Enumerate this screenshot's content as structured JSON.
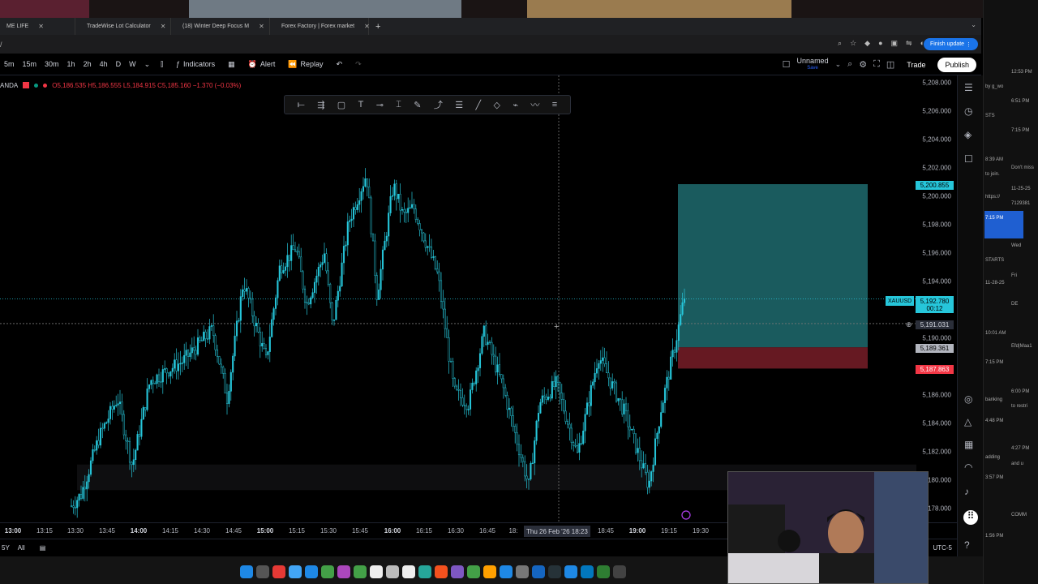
{
  "colors": {
    "accent": "#26c6da",
    "down": "#f23645",
    "up": "#089981",
    "target_zone": "#1e6b6e",
    "stop_zone": "#6b1a24",
    "blue_button": "#1a73e8"
  },
  "browser": {
    "tabs": [
      {
        "label": "ME LIFE",
        "icon": "tab-favicon"
      },
      {
        "label": "TradeWise Lot Calculator",
        "icon": "tab-favicon"
      },
      {
        "label": "(18) Winter Deep Focus M",
        "icon": "youtube-icon"
      },
      {
        "label": "Forex Factory | Forex market",
        "icon": "tab-favicon"
      }
    ],
    "address_fragment": "/",
    "finish_update": "Finish update"
  },
  "toolbar": {
    "timeframes": [
      "5m",
      "15m",
      "30m",
      "1h",
      "2h",
      "4h",
      "D",
      "W"
    ],
    "indicators_label": "Indicators",
    "alert_label": "Alert",
    "replay_label": "Replay",
    "layout_name": "Unnamed",
    "layout_sub": "Save",
    "trade_label": "Trade",
    "publish_label": "Publish"
  },
  "legend": {
    "symbol": "ANDA",
    "ohlc": "O5,186.535  H5,186.555  L5,184.915  C5,185.160  −1.370 (−0.03%)"
  },
  "drawing_tools": [
    "horizontal-line-icon",
    "channel-icon",
    "rectangle-icon",
    "text-icon",
    "ray-icon",
    "fib-icon",
    "brush-icon",
    "curve-icon",
    "parallel-channel-icon",
    "trend-line-icon",
    "shape-icon",
    "path-icon",
    "wave-icon",
    "menu-icon"
  ],
  "price_axis": {
    "ticks": [
      "5,208.000",
      "5,206.000",
      "5,204.000",
      "5,202.000",
      "5,200.000",
      "5,198.000",
      "5,196.000",
      "5,194.000",
      "5,190.000",
      "5,186.000",
      "5,184.000",
      "5,182.000",
      "5,180.000",
      "5,178.000"
    ],
    "target_label": "5,200.855",
    "last_price": "5,192.780",
    "countdown": "00:12",
    "crosshair_price": "5,191.031",
    "entry_label": "5,189.361",
    "stop_label": "5,187.863",
    "symbol_tag": "XAUUSD"
  },
  "time_axis": {
    "ticks": [
      "13:00",
      "13:15",
      "13:30",
      "13:45",
      "14:00",
      "14:15",
      "14:30",
      "14:45",
      "15:00",
      "15:15",
      "15:30",
      "15:45",
      "16:00",
      "16:15",
      "16:30",
      "16:45",
      "18:",
      "18:45",
      "19:00",
      "19:15",
      "19:30"
    ],
    "crosshair_time": "Thu 26 Feb '26   18:23"
  },
  "bottom": {
    "range": "5Y",
    "all": "All",
    "timezone": "UTC-5"
  },
  "side_panel": {
    "notes": [
      "12:53 PM",
      "by g_wo",
      "6:51 PM",
      "STS",
      "7:15 PM",
      "8:39 AM",
      "Don't miss",
      "to join.",
      "11-25-25",
      "https://",
      "7129381",
      "7:15 PM",
      "Wed",
      "STARTS",
      "Fri",
      "11-28-25",
      "DE",
      "10:01 AM",
      "Efd|Maa1",
      "7:15 PM",
      "6:00 PM",
      "banking",
      "to restri",
      "4:48 PM",
      "4:27 PM",
      "adding",
      "and u",
      "3:57 PM",
      "COMM",
      "1:56 PM"
    ]
  }
}
